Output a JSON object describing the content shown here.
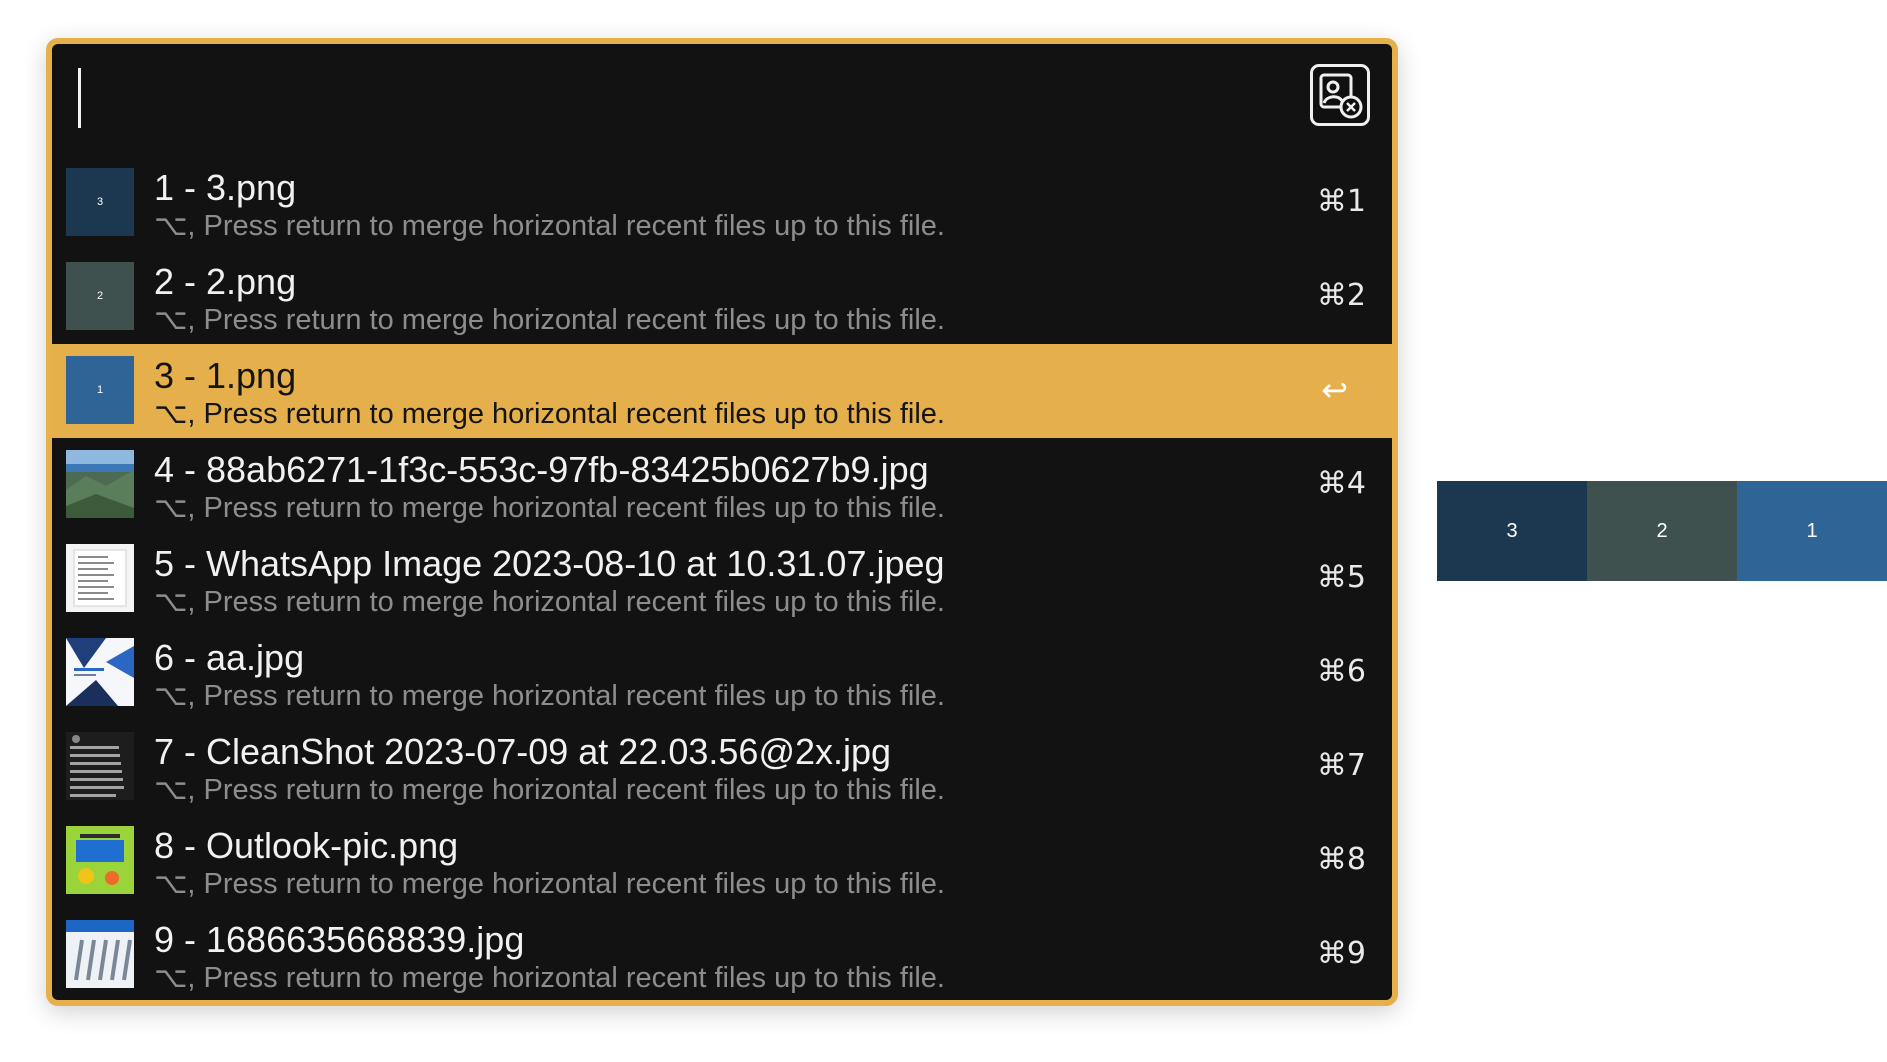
{
  "search": {
    "value": "",
    "placeholder": ""
  },
  "app_icon": "image-merge-icon",
  "results": [
    {
      "title": "1 - 3.png",
      "subtitle": "⌥, Press return to merge horizontal recent files up to this file.",
      "shortcut": "⌘1",
      "thumb": {
        "kind": "solid",
        "color": "#1c3850",
        "label": "3"
      }
    },
    {
      "title": "2 - 2.png",
      "subtitle": "⌥, Press return to merge horizontal recent files up to this file.",
      "shortcut": "⌘2",
      "thumb": {
        "kind": "solid",
        "color": "#3f514f",
        "label": "2"
      }
    },
    {
      "title": "3 - 1.png",
      "subtitle": "⌥, Press return to merge horizontal recent files up to this file.",
      "shortcut": "↩",
      "selected": true,
      "thumb": {
        "kind": "solid",
        "color": "#2e6496",
        "label": "1"
      }
    },
    {
      "title": "4 - 88ab6271-1f3c-553c-97fb-83425b0627b9.jpg",
      "subtitle": "⌥, Press return to merge horizontal recent files up to this file.",
      "shortcut": "⌘4",
      "thumb": {
        "kind": "photo-landscape"
      }
    },
    {
      "title": "5 - WhatsApp Image 2023-08-10 at 10.31.07.jpeg",
      "subtitle": "⌥, Press return to merge horizontal recent files up to this file.",
      "shortcut": "⌘5",
      "thumb": {
        "kind": "photo-document"
      }
    },
    {
      "title": "6 - aa.jpg",
      "subtitle": "⌥, Press return to merge horizontal recent files up to this file.",
      "shortcut": "⌘6",
      "thumb": {
        "kind": "photo-poster"
      }
    },
    {
      "title": "7 - CleanShot 2023-07-09 at 22.03.56@2x.jpg",
      "subtitle": "⌥, Press return to merge horizontal recent files up to this file.",
      "shortcut": "⌘7",
      "thumb": {
        "kind": "photo-screenshot"
      }
    },
    {
      "title": "8 - Outlook-pic.png",
      "subtitle": "⌥, Press return to merge horizontal recent files up to this file.",
      "shortcut": "⌘8",
      "thumb": {
        "kind": "photo-flyer"
      }
    },
    {
      "title": "9 - 1686635668839.jpg",
      "subtitle": "⌥, Press return to merge horizontal recent files up to this file.",
      "shortcut": "⌘9",
      "thumb": {
        "kind": "photo-pens"
      }
    }
  ],
  "preview": [
    {
      "label": "3",
      "color": "#1c3850"
    },
    {
      "label": "2",
      "color": "#3f514f"
    },
    {
      "label": "1",
      "color": "#2e6496"
    }
  ]
}
